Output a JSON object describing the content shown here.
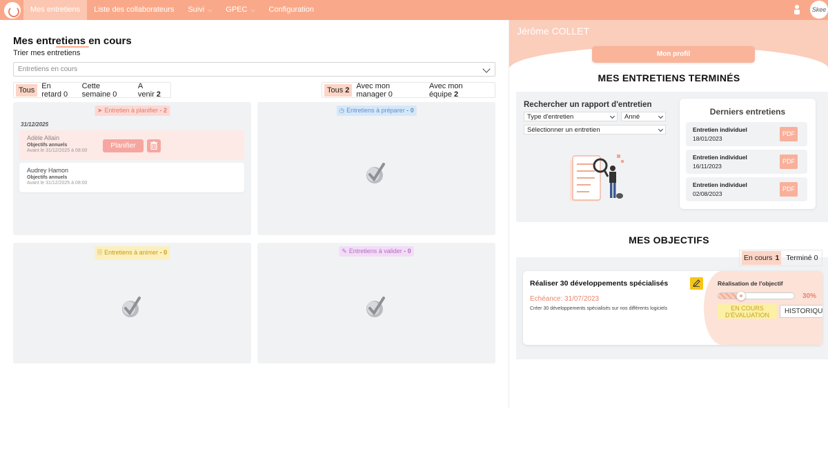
{
  "nav": {
    "items": [
      {
        "label": "Mes entretiens",
        "active": true,
        "has_dropdown": false
      },
      {
        "label": "Liste des collaborateurs",
        "active": false,
        "has_dropdown": false
      },
      {
        "label": "Suivi",
        "active": false,
        "has_dropdown": true
      },
      {
        "label": "GPEC",
        "active": false,
        "has_dropdown": true
      },
      {
        "label": "Configuration",
        "active": false,
        "has_dropdown": false
      }
    ],
    "avatar_text": "Skee"
  },
  "left": {
    "title": "Mes entretiens en cours",
    "sort_label": "Trier mes entretiens",
    "select_placeholder": "Entretiens en cours",
    "filters_time": [
      {
        "label": "Tous",
        "count": "",
        "selected": true,
        "bold": false
      },
      {
        "label": "En retard",
        "count": "0",
        "selected": false,
        "bold": false
      },
      {
        "label": "Cette semaine",
        "count": "0",
        "selected": false,
        "bold": false
      },
      {
        "label": "A venir",
        "count": "2",
        "selected": false,
        "bold": true
      }
    ],
    "filters_scope": [
      {
        "label": "Tous",
        "count": "2",
        "selected": true,
        "bold": true
      },
      {
        "label": "Avec mon manager",
        "count": "0",
        "selected": false,
        "bold": false
      },
      {
        "label": "Avec mon équipe",
        "count": "2",
        "selected": false,
        "bold": true
      }
    ],
    "cards": {
      "plan": {
        "label": "Entretien à planifier",
        "count": "- 2"
      },
      "prepare": {
        "label": "Entretiens à préparer",
        "count": "- 0"
      },
      "animate": {
        "label": "Entretiens à animer",
        "count": "- 0"
      },
      "validate": {
        "label": "Entretiens à valider",
        "count": "- 0"
      }
    },
    "plan_date": "31/12/2025",
    "plan_items": [
      {
        "name": "Adèle Allain",
        "type": "Objectifs annuels",
        "deadline": "Avant le 31/12/2025 à 08:00"
      },
      {
        "name": "Audrey Hamon",
        "type": "Objectifs annuels",
        "deadline": "Avant le 31/12/2025 à 08:00"
      }
    ],
    "plan_button": "Planifier"
  },
  "right": {
    "user_name": "Jérôme COLLET",
    "profile_button": "Mon profil",
    "done_title": "MES ENTRETIENS TERMINÉS",
    "search_title": "Rechercher un rapport d'entretien",
    "type_select": "Type d'entretien",
    "year_select": "Anné",
    "interview_select": "Sélectionner un entretien",
    "last_title": "Derniers entretiens",
    "last_items": [
      {
        "title": "Entretien individuel",
        "date": "18/01/2023",
        "pdf": "PDF"
      },
      {
        "title": "Entretien individuel",
        "date": "16/11/2023",
        "pdf": "PDF"
      },
      {
        "title": "Entretien individuel",
        "date": "02/08/2023",
        "pdf": "PDF"
      }
    ],
    "objectives_title": "MES OBJECTIFS",
    "obj_filters": {
      "in_progress": "En cours",
      "in_progress_count": "1",
      "done": "Terminé",
      "done_count": "0"
    },
    "objective": {
      "title": "Réaliser 30 développements spécialisés",
      "due": "Echéance: 31/07/2023",
      "description": "Créer 30 développements spécialisés sur nos différents logiciels",
      "progress_label": "Réalisation de l'objectif",
      "progress_percent": 30,
      "progress_text": "30%",
      "status": "EN COURS D'ÉVALUATION",
      "history_button": "HISTORIQU"
    }
  },
  "colors": {
    "accent": "#f9a98a",
    "panel": "#f1f2f4",
    "status_yellow": "#fbf0a4"
  }
}
